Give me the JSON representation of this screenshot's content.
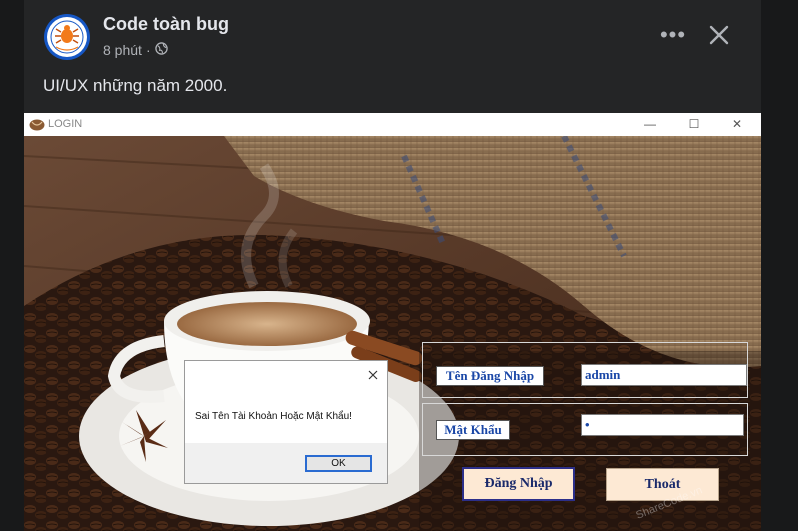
{
  "post": {
    "page_name": "Code toàn bug",
    "time": "8 phút",
    "text": "UI/UX những năm 2000.",
    "more_label": "•••"
  },
  "app": {
    "title": "LOGIN",
    "window_controls": {
      "minimize": "—",
      "maximize": "☐",
      "close": "✕"
    },
    "username_label": "Tên Đăng Nhập",
    "username_value": "admin",
    "password_label": "Mật Khẩu",
    "password_value": "•",
    "login_button": "Đăng Nhập",
    "exit_button": "Thoát"
  },
  "dialog": {
    "message": "Sai Tên Tài Khoản Hoặc Mật Khẩu!",
    "ok_label": "OK"
  },
  "colors": {
    "page_bg": "#18191a",
    "card_bg": "#242526",
    "label_text": "#1a47a7",
    "button_bg": "#fde9d4"
  }
}
